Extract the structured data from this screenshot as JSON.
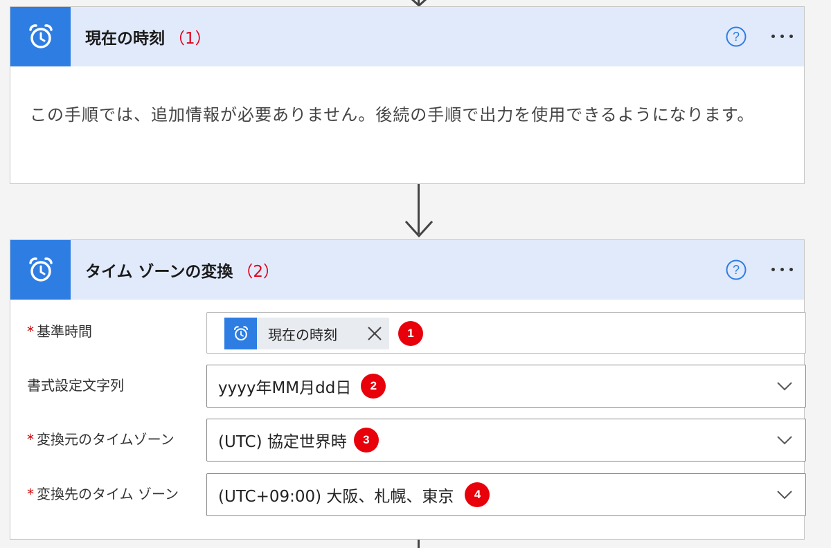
{
  "step1": {
    "title": "現在の時刻",
    "annotation": "（1）",
    "body": "この手順では、追加情報が必要ありません。後続の手順で出力を使用できるようになります。",
    "icon": "alarm-clock-icon",
    "help_icon": "help-circle-icon",
    "more_icon": "ellipsis-icon"
  },
  "step2": {
    "title": "タイム ゾーンの変換",
    "annotation": "（2）",
    "icon": "alarm-clock-icon",
    "fields": {
      "base_time": {
        "label": "基準時間",
        "required": "*",
        "token": "現在の時刻",
        "badge": "1"
      },
      "format_string": {
        "label": "書式設定文字列",
        "value": "yyyy年MM月dd日",
        "badge": "2"
      },
      "source_tz": {
        "label": "変換元のタイムゾーン",
        "required": "*",
        "value": "(UTC) 協定世界時",
        "badge": "3"
      },
      "dest_tz": {
        "label": "変換先のタイム ゾーン",
        "required": "*",
        "value": "(UTC+09:00) 大阪、札幌、東京",
        "badge": "4"
      }
    }
  },
  "colors": {
    "accent": "#2d7de3",
    "header_bg": "#e1eafb",
    "annotation_red": "#e0001b",
    "badge_red": "#e8000b"
  }
}
